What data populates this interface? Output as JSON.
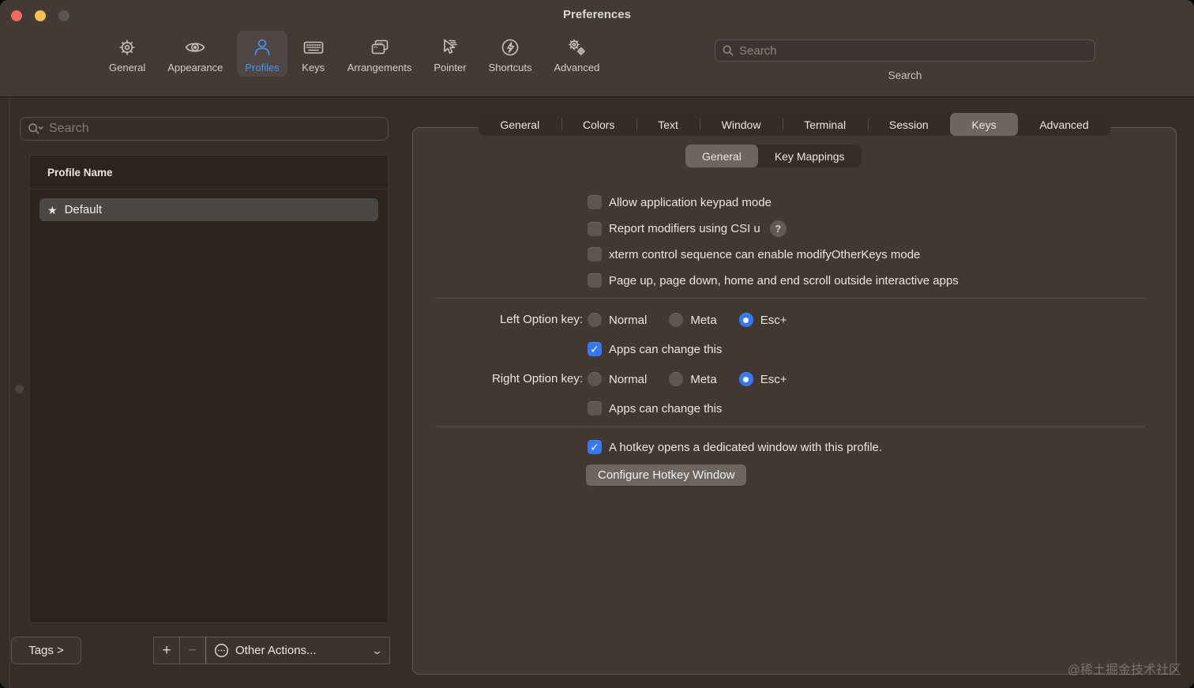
{
  "window": {
    "title": "Preferences"
  },
  "toolbar": {
    "items": [
      {
        "label": "General",
        "selected": false
      },
      {
        "label": "Appearance",
        "selected": false
      },
      {
        "label": "Profiles",
        "selected": true
      },
      {
        "label": "Keys",
        "selected": false
      },
      {
        "label": "Arrangements",
        "selected": false
      },
      {
        "label": "Pointer",
        "selected": false
      },
      {
        "label": "Shortcuts",
        "selected": false
      },
      {
        "label": "Advanced",
        "selected": false
      }
    ],
    "search": {
      "placeholder": "Search",
      "caption": "Search"
    }
  },
  "sidebar": {
    "search": {
      "placeholder": "Search"
    },
    "profiles": {
      "header": "Profile Name",
      "rows": [
        {
          "name": "Default",
          "starred": true,
          "selected": true
        }
      ]
    },
    "tags_button": "Tags >",
    "add_button": "+",
    "remove_button": "−",
    "other_actions": {
      "label": "Other Actions..."
    }
  },
  "panel": {
    "tabs": [
      {
        "label": "General",
        "selected": false
      },
      {
        "label": "Colors",
        "selected": false
      },
      {
        "label": "Text",
        "selected": false
      },
      {
        "label": "Window",
        "selected": false
      },
      {
        "label": "Terminal",
        "selected": false
      },
      {
        "label": "Session",
        "selected": false
      },
      {
        "label": "Keys",
        "selected": true
      },
      {
        "label": "Advanced",
        "selected": false
      }
    ],
    "subtabs": [
      {
        "label": "General",
        "selected": true
      },
      {
        "label": "Key Mappings",
        "selected": false
      }
    ],
    "general_checkboxes": [
      {
        "label": "Allow application keypad mode",
        "checked": false
      },
      {
        "label": "Report modifiers using CSI u",
        "checked": false,
        "has_help": true
      },
      {
        "label": "xterm control sequence can enable modifyOtherKeys mode",
        "checked": false
      },
      {
        "label": "Page up, page down, home and end scroll outside interactive apps",
        "checked": false
      }
    ],
    "help_icon_label": "?",
    "left_option": {
      "label": "Left Option key:",
      "options": [
        {
          "label": "Normal",
          "selected": false
        },
        {
          "label": "Meta",
          "selected": false
        },
        {
          "label": "Esc+",
          "selected": true
        }
      ],
      "apps_can_change": {
        "label": "Apps can change this",
        "checked": true
      }
    },
    "right_option": {
      "label": "Right Option key:",
      "options": [
        {
          "label": "Normal",
          "selected": false
        },
        {
          "label": "Meta",
          "selected": false
        },
        {
          "label": "Esc+",
          "selected": true
        }
      ],
      "apps_can_change": {
        "label": "Apps can change this",
        "checked": false
      }
    },
    "hotkey": {
      "label": "A hotkey opens a dedicated window with this profile.",
      "checked": true,
      "button": "Configure Hotkey Window"
    }
  },
  "watermark": "@稀土掘金技术社区",
  "colors": {
    "accent_blue": "#3478f6",
    "profiles_blue": "#4795f7",
    "traffic_red": "#ee6a5e",
    "traffic_yellow": "#f6bf4f",
    "traffic_gray": "#5c5650",
    "titlebar_bg": "#413a35",
    "content_bg": "#372d28",
    "panel_bg": "#423831",
    "list_bg": "#2d221d",
    "selected_segment": "#6d6660"
  }
}
